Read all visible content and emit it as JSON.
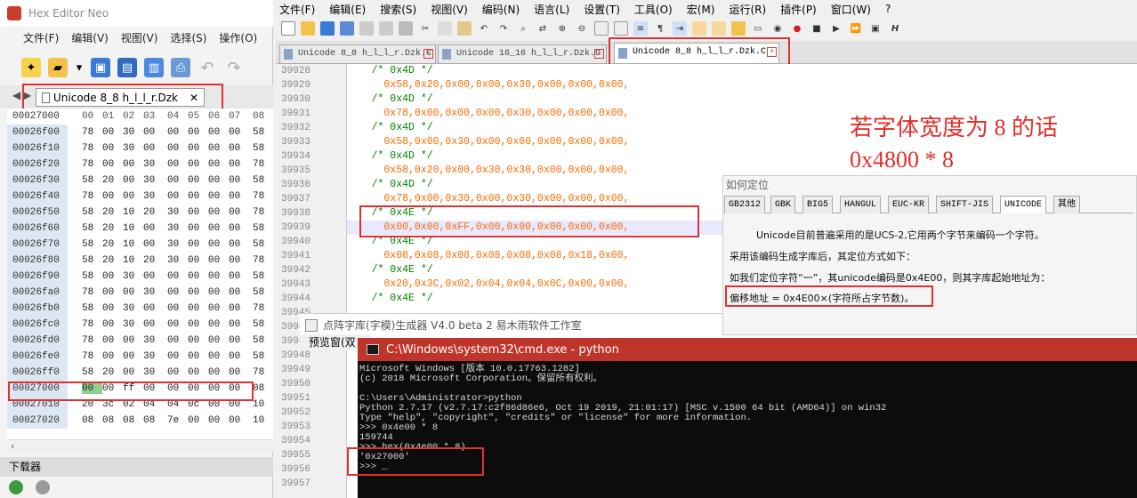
{
  "hex": {
    "title": "Hex Editor Neo",
    "menu": [
      "文件(F)",
      "编辑(V)",
      "视图(V)",
      "选择(S)",
      "操作(O)"
    ],
    "tab": "Unicode 8_8 h_l_l_r.Dzk",
    "header": {
      "offset": "00027000",
      "bytes": [
        "00",
        "01",
        "02",
        "03",
        "04",
        "05",
        "06",
        "07",
        "08"
      ]
    },
    "rows": [
      {
        "off": "00026f00",
        "bytes": [
          "78",
          "00",
          "30",
          "00",
          "00",
          "00",
          "00",
          "00",
          "58"
        ]
      },
      {
        "off": "00026f10",
        "bytes": [
          "78",
          "00",
          "30",
          "00",
          "00",
          "00",
          "00",
          "00",
          "58"
        ]
      },
      {
        "off": "00026f20",
        "bytes": [
          "78",
          "00",
          "00",
          "30",
          "00",
          "00",
          "00",
          "00",
          "78"
        ]
      },
      {
        "off": "00026f30",
        "bytes": [
          "58",
          "20",
          "00",
          "30",
          "00",
          "00",
          "00",
          "00",
          "58"
        ]
      },
      {
        "off": "00026f40",
        "bytes": [
          "78",
          "00",
          "00",
          "30",
          "00",
          "00",
          "00",
          "00",
          "78"
        ]
      },
      {
        "off": "00026f50",
        "bytes": [
          "58",
          "20",
          "10",
          "20",
          "30",
          "00",
          "00",
          "00",
          "78"
        ]
      },
      {
        "off": "00026f60",
        "bytes": [
          "58",
          "20",
          "10",
          "00",
          "30",
          "00",
          "00",
          "00",
          "58"
        ]
      },
      {
        "off": "00026f70",
        "bytes": [
          "58",
          "20",
          "10",
          "00",
          "30",
          "00",
          "00",
          "00",
          "58"
        ]
      },
      {
        "off": "00026f80",
        "bytes": [
          "58",
          "20",
          "10",
          "20",
          "30",
          "00",
          "00",
          "00",
          "78"
        ]
      },
      {
        "off": "00026f90",
        "bytes": [
          "58",
          "00",
          "30",
          "00",
          "00",
          "00",
          "00",
          "00",
          "58"
        ]
      },
      {
        "off": "00026fa0",
        "bytes": [
          "78",
          "00",
          "00",
          "30",
          "00",
          "00",
          "00",
          "00",
          "58"
        ]
      },
      {
        "off": "00026fb0",
        "bytes": [
          "58",
          "00",
          "30",
          "00",
          "00",
          "00",
          "00",
          "00",
          "78"
        ]
      },
      {
        "off": "00026fc0",
        "bytes": [
          "78",
          "00",
          "30",
          "00",
          "00",
          "00",
          "00",
          "00",
          "58"
        ]
      },
      {
        "off": "00026fd0",
        "bytes": [
          "78",
          "00",
          "00",
          "30",
          "00",
          "00",
          "00",
          "00",
          "58"
        ]
      },
      {
        "off": "00026fe0",
        "bytes": [
          "78",
          "00",
          "00",
          "30",
          "00",
          "00",
          "00",
          "00",
          "58"
        ]
      },
      {
        "off": "00026ff0",
        "bytes": [
          "58",
          "20",
          "00",
          "30",
          "00",
          "00",
          "00",
          "00",
          "78"
        ]
      },
      {
        "off": "00027000",
        "bytes": [
          "00",
          "00",
          "ff",
          "00",
          "00",
          "00",
          "00",
          "00",
          "08"
        ]
      },
      {
        "off": "00027010",
        "bytes": [
          "20",
          "3c",
          "02",
          "04",
          "04",
          "0c",
          "00",
          "00",
          "10"
        ]
      },
      {
        "off": "00027020",
        "bytes": [
          "08",
          "08",
          "08",
          "08",
          "7e",
          "00",
          "00",
          "00",
          "10"
        ]
      }
    ],
    "downloader": "下载器"
  },
  "src": {
    "menu": [
      "文件(F)",
      "编辑(E)",
      "搜索(S)",
      "视图(V)",
      "编码(N)",
      "语言(L)",
      "设置(T)",
      "工具(O)",
      "宏(M)",
      "运行(R)",
      "插件(P)",
      "窗口(W)",
      "?"
    ],
    "tabs": [
      "Unicode 8_8 h_l_l_r.Dzk.C",
      "Unicode 16_16 h_l_l_r.Dzk.C",
      "Unicode 8_8 h_l_l_r.Dzk.C"
    ],
    "line_numbers": [
      "39928",
      "39929",
      "39930",
      "39931",
      "39932",
      "39933",
      "39934",
      "39935",
      "39936",
      "39937",
      "39938",
      "39939",
      "39940",
      "39941",
      "39942",
      "39943",
      "39944",
      "39945",
      "39946",
      "39947",
      "39948",
      "39949",
      "39950",
      "39951",
      "39952",
      "39953",
      "39954",
      "39955",
      "39956",
      "39957"
    ],
    "lines": [
      {
        "t": "c",
        "s": "    /* 0x4D */"
      },
      {
        "t": "n",
        "s": "      0x58,0x20,0x00,0x00,0x30,0x00,0x00,0x00,"
      },
      {
        "t": "c",
        "s": "    /* 0x4D */"
      },
      {
        "t": "n",
        "s": "      0x78,0x00,0x00,0x00,0x30,0x00,0x00,0x00,"
      },
      {
        "t": "c",
        "s": "    /* 0x4D */"
      },
      {
        "t": "n",
        "s": "      0x58,0x00,0x30,0x00,0x00,0x00,0x00,0x00,"
      },
      {
        "t": "c",
        "s": "    /* 0x4D */"
      },
      {
        "t": "n",
        "s": "      0x58,0x20,0x00,0x30,0x30,0x00,0x00,0x00,"
      },
      {
        "t": "c",
        "s": "    /* 0x4D */"
      },
      {
        "t": "n",
        "s": "      0x78,0x00,0x30,0x00,0x30,0x00,0x00,0x00,"
      },
      {
        "t": "c",
        "s": "    /* 0x4E */"
      },
      {
        "t": "n",
        "s": "      0x00,0x00,0xFF,0x00,0x00,0x00,0x00,0x00,"
      },
      {
        "t": "c",
        "s": "    /* 0x4E */"
      },
      {
        "t": "n",
        "s": "      0x08,0x08,0x08,0x08,0x08,0x08,0x18,0x00,"
      },
      {
        "t": "c",
        "s": "    /* 0x4E */"
      },
      {
        "t": "n",
        "s": "      0x20,0x3C,0x02,0x04,0x04,0x0C,0x00,0x00,"
      },
      {
        "t": "c",
        "s": "    /* 0x4E */"
      }
    ],
    "annotation": [
      "若字体宽度为 8 的话",
      "0x4800 * 8"
    ]
  },
  "locate": {
    "title": "如何定位",
    "tabs": [
      "GB2312",
      "GBK",
      "BIG5",
      "HANGUL",
      "EUC-KR",
      "SHIFT-JIS",
      "UNICODE",
      "其他"
    ],
    "lines": [
      "Unicode目前普遍采用的是UCS-2,它用两个字节来编码一个字符。",
      "采用该编码生成字库后，其定位方式如下：",
      "如我们定位字符“一”，其unicode编码是0x4E00，则其字库起始地址为：",
      "偏移地址 = 0x4E00×(字符所占字节数)。"
    ]
  },
  "dz": {
    "title": "点阵字库(字模)生成器 V4.0 beta 2 易木雨软件工作室",
    "sub": "预览窗(双"
  },
  "cmd": {
    "title": "C:\\Windows\\system32\\cmd.exe - python",
    "lines": [
      "Microsoft Windows [版本 10.0.17763.1282]",
      "(c) 2018 Microsoft Corporation。保留所有权利。",
      "",
      "C:\\Users\\Administrator>python",
      "Python 2.7.17 (v2.7.17:c2f86d86e6, Oct 19 2019, 21:01:17) [MSC v.1500 64 bit (AMD64)] on win32",
      "Type \"help\", \"copyright\", \"credits\" or \"license\" for more information.",
      ">>> 0x4e00 * 8",
      "159744",
      ">>> hex(0x4e00 * 8)",
      "'0x27000'",
      ">>> _"
    ]
  },
  "colors": {
    "accent_red": "#e03030",
    "comment": "#008000",
    "number": "#ff6a00",
    "cmd_title": "#c0352b"
  }
}
